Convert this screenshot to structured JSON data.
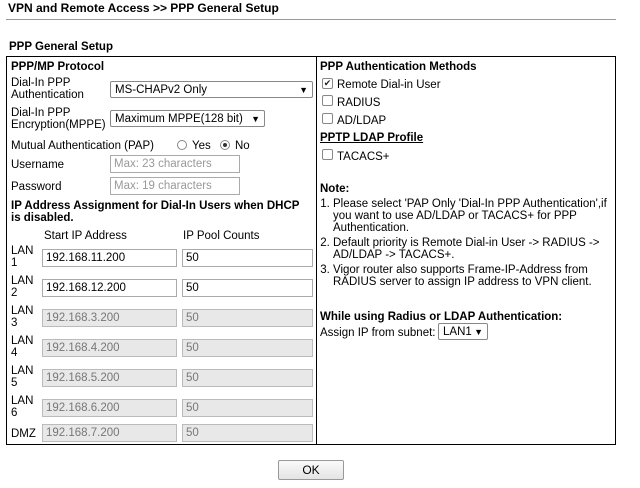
{
  "page": {
    "title": "VPN and Remote Access >> PPP General Setup",
    "section_title": "PPP General Setup",
    "ok_label": "OK"
  },
  "left": {
    "heading": "PPP/MP Protocol",
    "dialin_auth": {
      "label_line1": "Dial-In PPP",
      "label_line2": "Authentication",
      "value": "MS-CHAPv2 Only"
    },
    "dialin_enc": {
      "label_line1": "Dial-In PPP",
      "label_line2": "Encryption(MPPE)",
      "value": "Maximum MPPE(128 bit)"
    },
    "mutual_auth": {
      "label": "Mutual Authentication (PAP)",
      "yes_label": "Yes",
      "no_label": "No",
      "selected": "No"
    },
    "username": {
      "label": "Username",
      "placeholder": "Max: 23 characters"
    },
    "password": {
      "label": "Password",
      "placeholder": "Max: 19 characters"
    },
    "ip_heading_line1": "IP Address Assignment for Dial-In Users when DHCP",
    "ip_heading_line2": "is disabled.",
    "col_start_ip": "Start IP Address",
    "col_pool": "IP Pool Counts",
    "lans": [
      {
        "label_line1": "LAN",
        "label_line2": "1",
        "ip": "192.168.11.200",
        "count": "50",
        "enabled": true
      },
      {
        "label_line1": "LAN",
        "label_line2": "2",
        "ip": "192.168.12.200",
        "count": "50",
        "enabled": true
      },
      {
        "label_line1": "LAN",
        "label_line2": "3",
        "ip": "192.168.3.200",
        "count": "50",
        "enabled": false
      },
      {
        "label_line1": "LAN",
        "label_line2": "4",
        "ip": "192.168.4.200",
        "count": "50",
        "enabled": false
      },
      {
        "label_line1": "LAN",
        "label_line2": "5",
        "ip": "192.168.5.200",
        "count": "50",
        "enabled": false
      },
      {
        "label_line1": "LAN",
        "label_line2": "6",
        "ip": "192.168.6.200",
        "count": "50",
        "enabled": false
      }
    ],
    "dmz": {
      "label": "DMZ",
      "ip": "192.168.7.200",
      "count": "50",
      "enabled": false
    }
  },
  "right": {
    "heading": "PPP Authentication Methods",
    "methods": [
      {
        "label": "Remote Dial-in User",
        "checked": true
      },
      {
        "label": "RADIUS",
        "checked": false
      },
      {
        "label": "AD/LDAP",
        "checked": false
      }
    ],
    "pptp_heading": "PPTP LDAP Profile",
    "tacacs": {
      "label": "TACACS+",
      "checked": false
    },
    "note_heading": "Note:",
    "notes": [
      "Please select 'PAP Only 'Dial-In PPP Authentication',if you want to use AD/LDAP or TACACS+ for PPP Authentication.",
      "Default priority is Remote Dial-in User -> RADIUS -> AD/LDAP -> TACACS+.",
      "Vigor router also supports Frame-IP-Address from RADIUS server to assign IP address to VPN client."
    ],
    "radius_heading": "While using Radius or LDAP Authentication:",
    "assign_label": "Assign IP from subnet:",
    "assign_value": "LAN1"
  }
}
